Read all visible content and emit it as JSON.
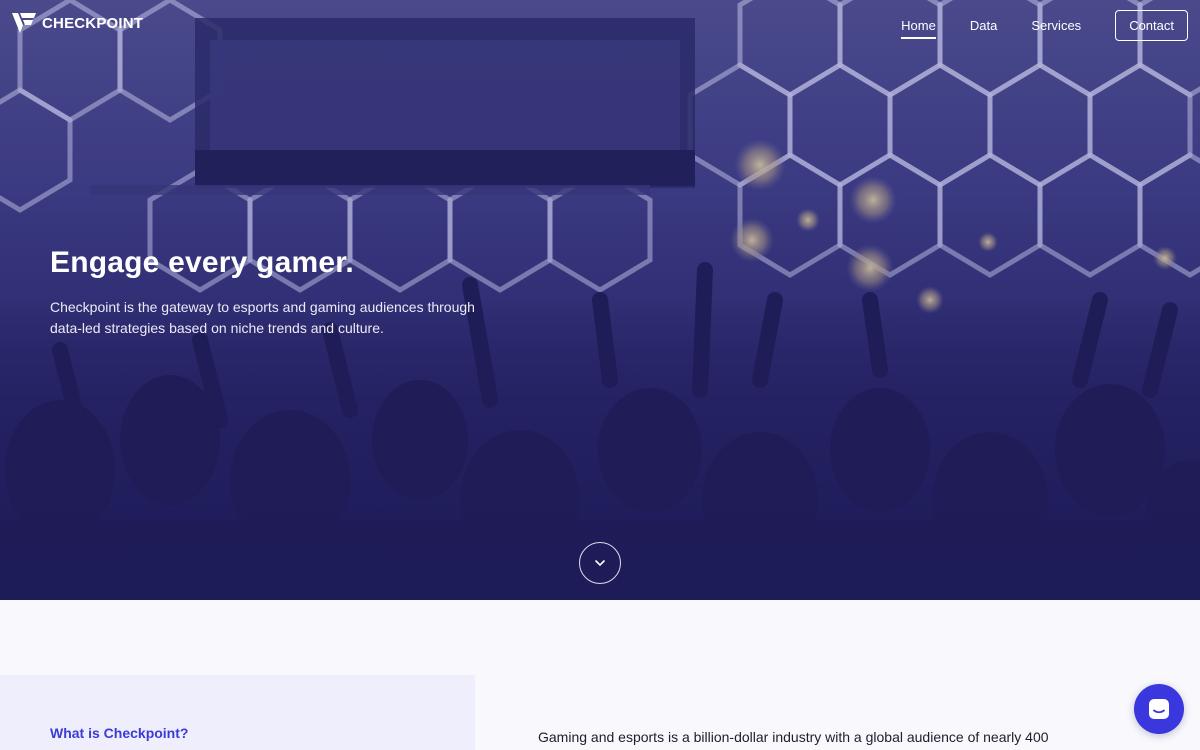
{
  "brand": {
    "name": "CHECKPOINT"
  },
  "nav": {
    "items": [
      {
        "label": "Home",
        "active": true
      },
      {
        "label": "Data",
        "active": false
      },
      {
        "label": "Services",
        "active": false
      }
    ],
    "cta_label": "Contact"
  },
  "hero": {
    "title": "Engage every gamer.",
    "subtitle": "Checkpoint is the gateway to esports and gaming audiences through data-led strategies based on niche trends and culture.",
    "scroll_icon": "chevron-down-icon",
    "background": "esports-arena-crowd"
  },
  "about": {
    "heading": "What is Checkpoint?",
    "text": "Gaming and esports is a billion-dollar industry with a global audience of nearly 400"
  },
  "chat": {
    "icon": "chat-icon"
  },
  "colors": {
    "hero_overlay": "#2e2c6f",
    "accent": "#3b3bd6",
    "chat_button": "#3a37de",
    "section_bg": "#f8f8fd",
    "card_bg": "#eeeefc"
  }
}
